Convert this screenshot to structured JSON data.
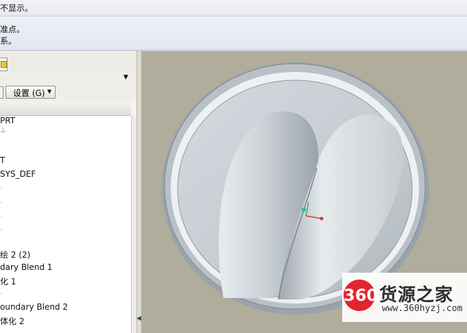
{
  "message_area": {
    "line_top": "不显示。",
    "line_1": "准点。",
    "line_2": "系。"
  },
  "toolbar": {
    "settings_label": "设置 (G)"
  },
  "model_tree": {
    "items": [
      "PRT",
      "T",
      "SYS_DEF",
      "绘 2 (2)",
      "dary Blend 1",
      "化 1",
      "oundary Blend 2",
      "体化 2"
    ]
  },
  "watermark": {
    "logo_text": "360",
    "brand": "货源之家",
    "url": "www.360hyzj.com"
  },
  "colors": {
    "viewport_bg": "#b0ad9d",
    "model_surface": "#c7ced3",
    "watermark_red": "#e5232e"
  }
}
